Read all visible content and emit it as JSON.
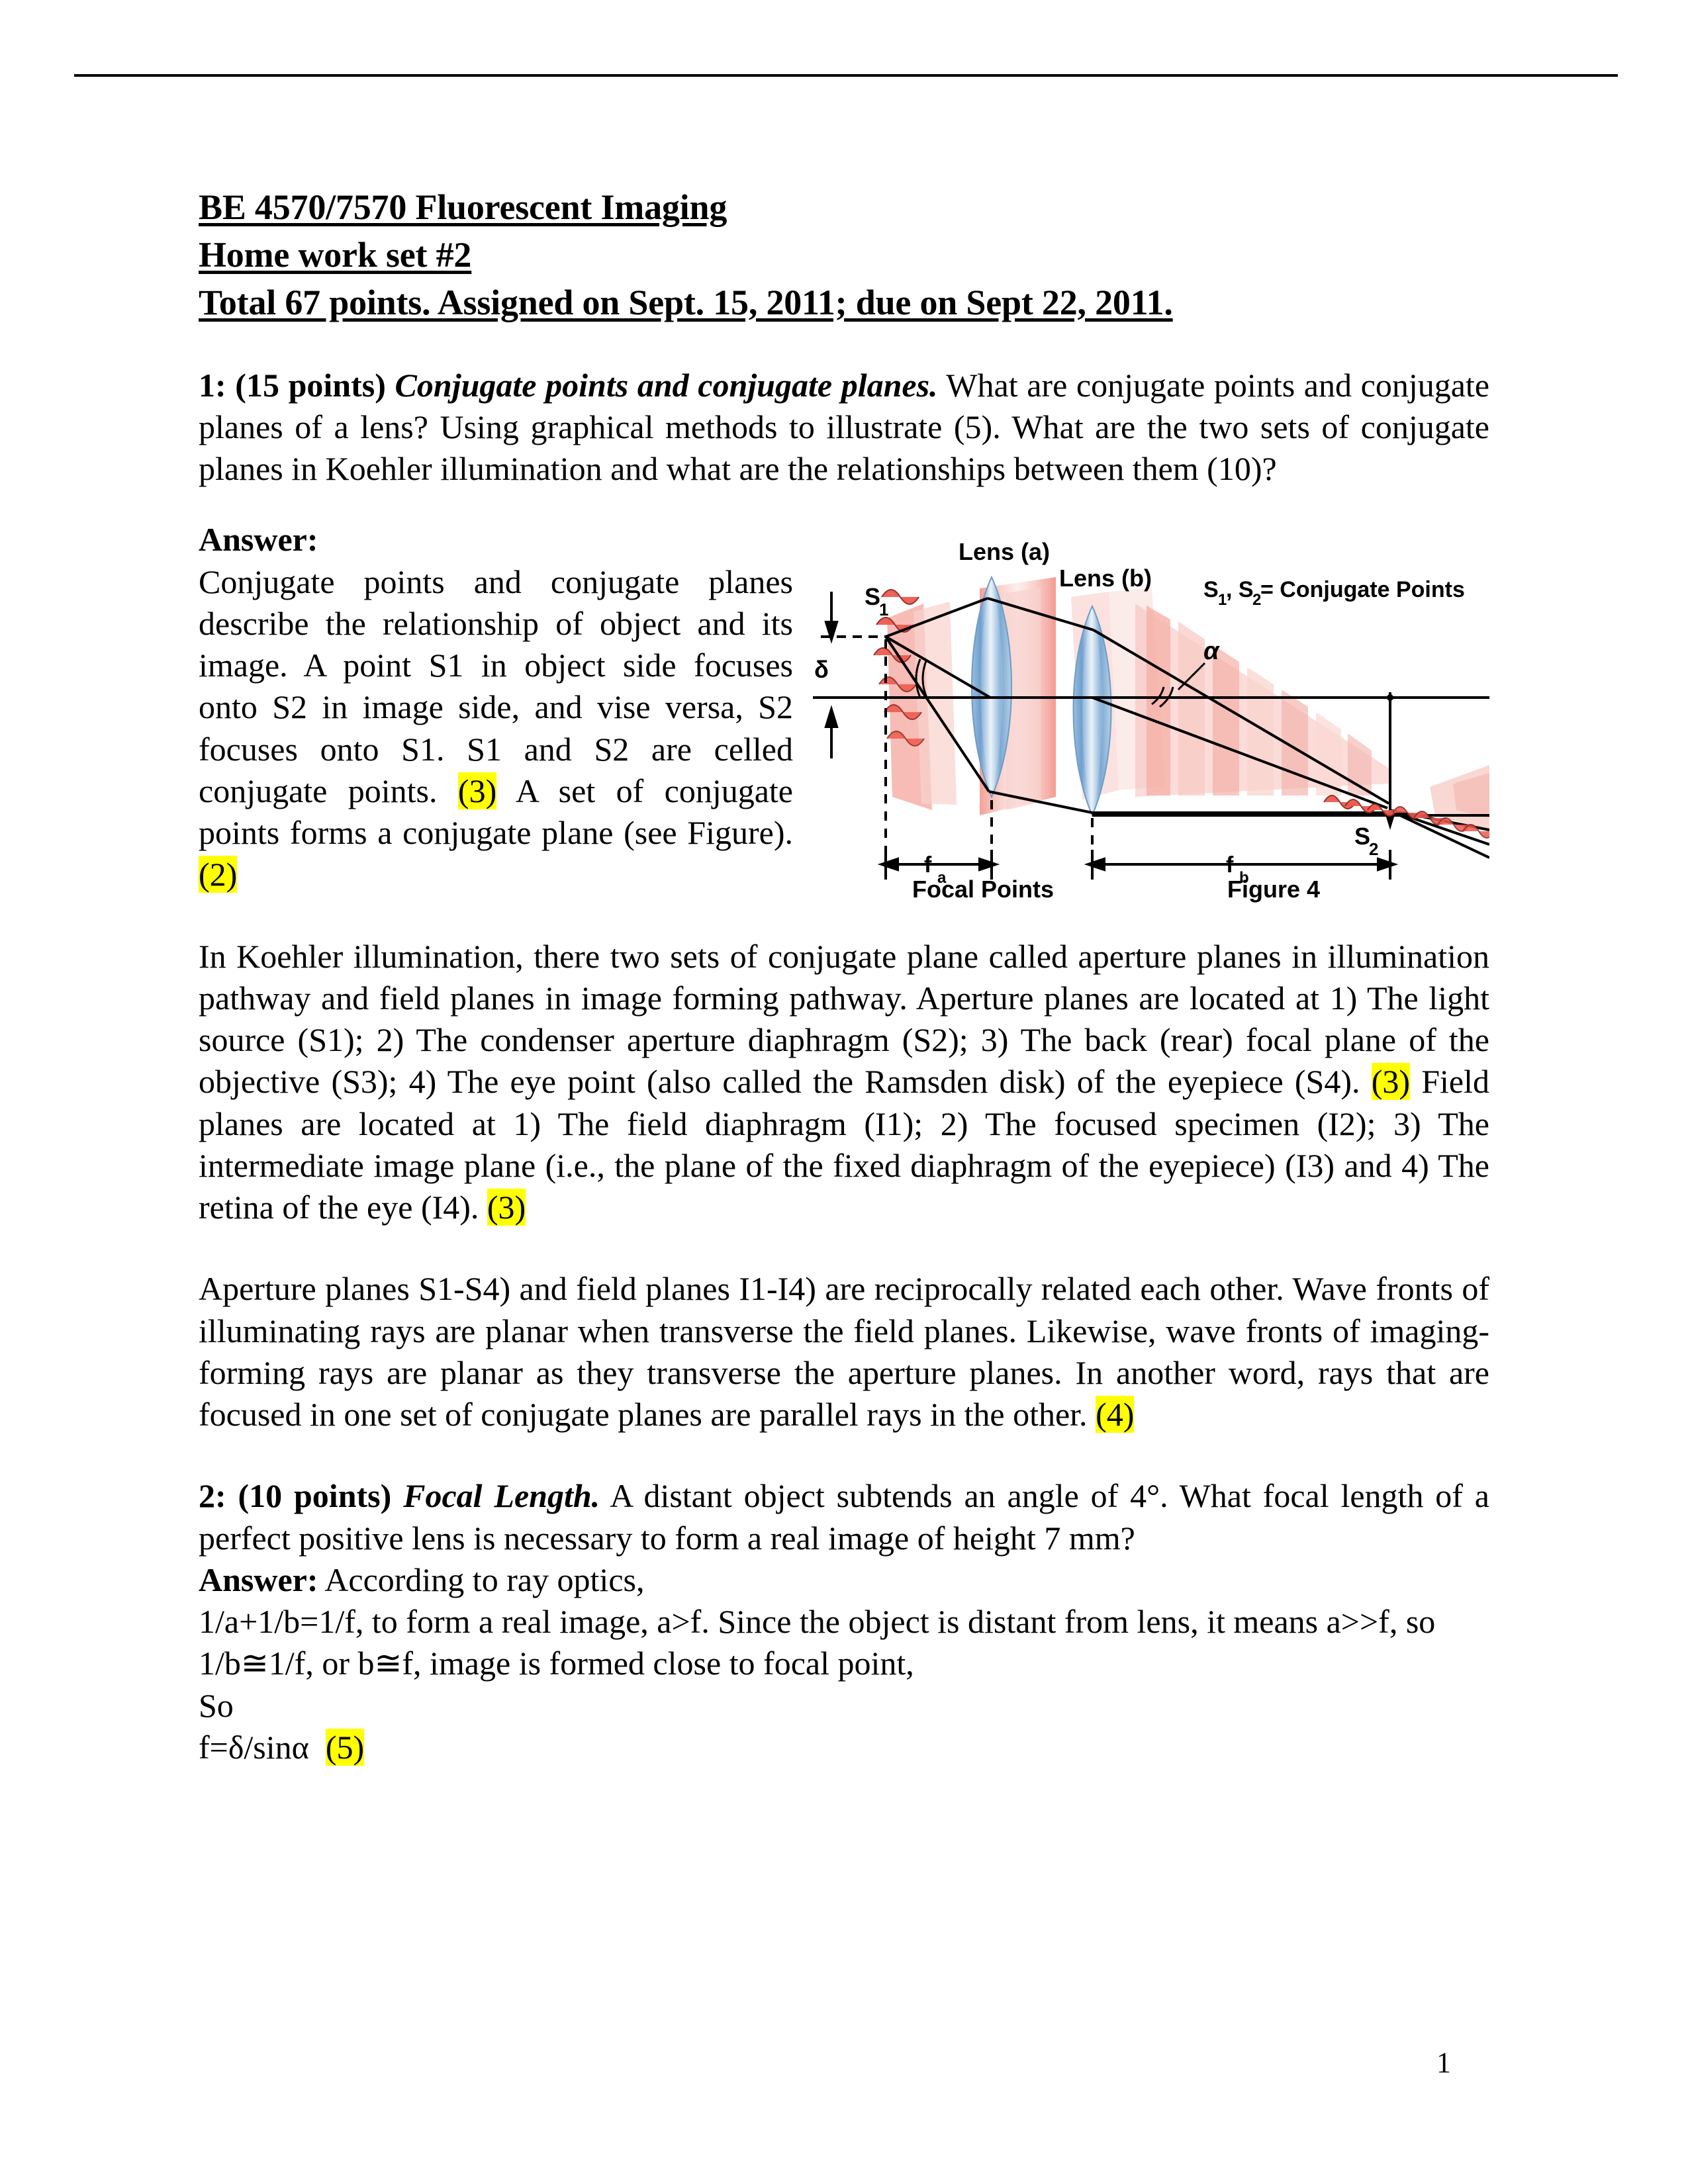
{
  "document": {
    "page_number": "1",
    "header_rule": true
  },
  "title": {
    "line1": "BE 4570/7570 Fluorescent Imaging",
    "line2": "Home work set #2",
    "line3": "Total 67 points.  Assigned on Sept. 15, 2011; due on Sept 22, 2011."
  },
  "question1": {
    "number_points": "1: (15 points)",
    "topic": "Conjugate points and conjugate planes.",
    "body": " What are conjugate points and conjugate planes of a lens? Using graphical methods to illustrate (5). What are the two sets of conjugate planes in Koehler illumination and what are the relationships between them (10)?",
    "answer_label": "Answer:",
    "answer_text_1": "Conjugate points and conjugate planes describe the relationship of object and its image.  A point S1 in object side focuses onto S2 in image side, and vise versa, S2 focuses onto S1. S1 and S2 are celled conjugate points. ",
    "score_3a": "(3)",
    "answer_text_2": " A set of conjugate points forms a conjugate plane (see Figure). ",
    "score_2": "(2)",
    "para2_part1": "In Koehler illumination, there two sets of conjugate plane called aperture planes in illumination pathway and field planes in image forming pathway. Aperture planes are located at 1) The light source (S1); 2) The condenser aperture diaphragm (S2); 3) The back (rear) focal plane of the objective (S3); 4) The eye point (also called the Ramsden disk) of the eyepiece (S4). ",
    "score_3b": "(3)",
    "para2_part2": " Field planes are located at 1) The field diaphragm (I1); 2) The focused specimen (I2); 3) The intermediate image plane (i.e., the plane of the fixed diaphragm of the eyepiece) (I3) and 4) The retina of the eye (I4). ",
    "score_3c": "(3)",
    "para3_text": "Aperture planes S1-S4) and field planes I1-I4) are reciprocally related each other. Wave fronts of illuminating rays are planar when transverse the field planes. Likewise, wave fronts of imaging-forming rays are planar as they transverse the aperture planes. In another word, rays that are focused in one set of conjugate planes are parallel rays in the other. ",
    "score_4": "(4)"
  },
  "question2": {
    "number_points": "2: (10 points)",
    "topic": "Focal Length.",
    "body": " A distant object subtends an angle of 4°. What focal length of a perfect positive lens is necessary to form a real image of height 7 mm?",
    "answer_label": "Answer:",
    "answer_intro": " According to ray optics,",
    "line_1": "1/a+1/b=1/f, to form a real image, a>f. Since the object is distant from lens, it means a>>f, so",
    "line_2": "1/b≅1/f, or b≅f, image is formed close to focal point,",
    "line_3": "So",
    "line_4": "f=δ/sinα",
    "score_5": "(5)"
  },
  "figure": {
    "name": "Figure 4",
    "caption": "Figure 4",
    "lens_a_label": "Lens (a)",
    "lens_b_label": "Lens (b)",
    "s1_label": "S",
    "s1_sub": "1",
    "s2_label": "S",
    "s2_sub": "2",
    "delta_label": "δ",
    "alpha_label": "α",
    "legend": "S₁, S₂ = Conjugate Points",
    "legend_prefix": "S",
    "legend_sub1": "1",
    "legend_mid": ", S",
    "legend_sub2": "2",
    "legend_suffix": " = Conjugate Points",
    "fa_label": "f",
    "fa_sub": "a",
    "fb_label": "f",
    "fb_sub": "b",
    "focal_points_label": "Focal Points",
    "colors": {
      "lens_blue": "#7ba7d4",
      "wave_red": "#e8534a",
      "wave_pink": "#f6c2bd",
      "highlight_yellow": "#ffff00",
      "ink": "#000000"
    }
  }
}
